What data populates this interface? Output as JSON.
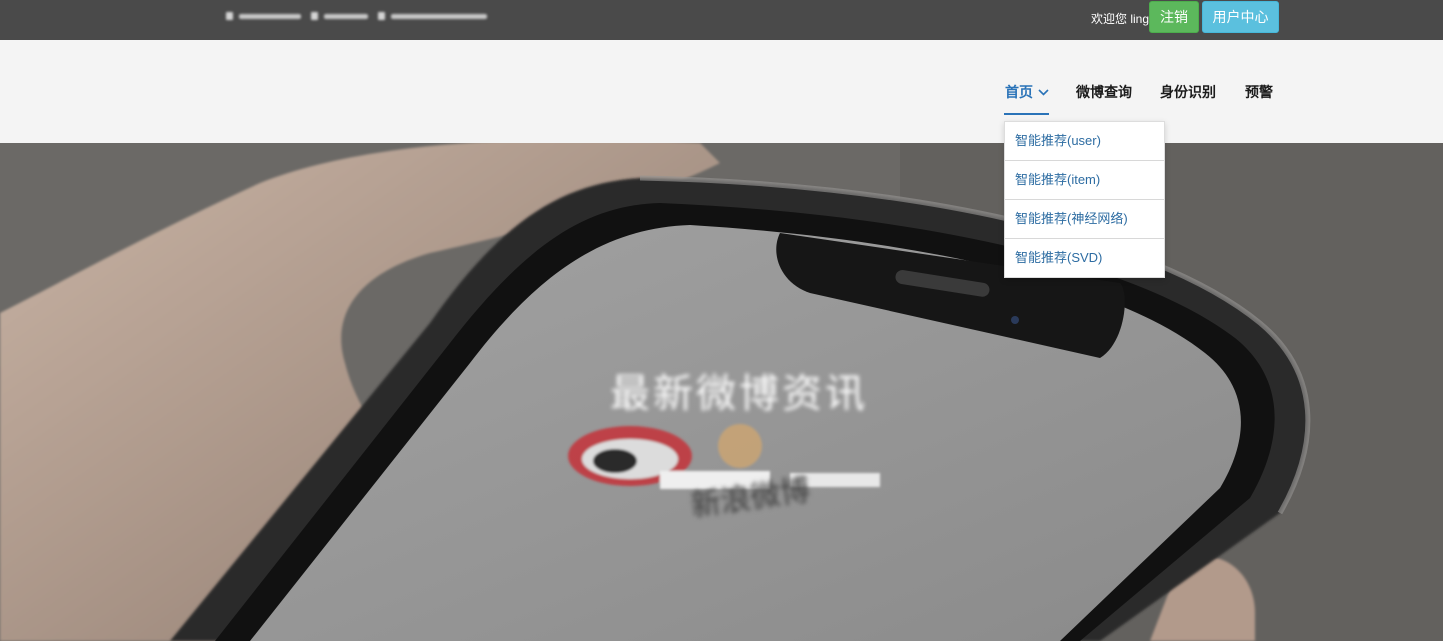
{
  "topbar": {
    "contact": [
      {
        "icon": "phone-icon"
      },
      {
        "icon": "mail-icon"
      },
      {
        "icon": "location-icon"
      }
    ],
    "welcome_text": "欢迎您 ling",
    "logout_label": "注销",
    "user_center_label": "用户中心",
    "colors": {
      "background": "#4a4a4a",
      "logout": "#5cb85c",
      "user_center": "#5bc0de"
    }
  },
  "nav": {
    "items": [
      {
        "label": "首页",
        "active": true,
        "icon": "chevron-down-icon"
      },
      {
        "label": "微博查询"
      },
      {
        "label": "身份识别"
      },
      {
        "label": "预警"
      }
    ],
    "accent": "#2a73b8",
    "dropdown": [
      {
        "label": "智能推荐(user)"
      },
      {
        "label": "智能推荐(item)"
      },
      {
        "label": "智能推荐(神经网络)"
      },
      {
        "label": "智能推荐(SVD)"
      }
    ]
  },
  "hero": {
    "title": "最新微博资讯",
    "subtitle": "新浪微博"
  }
}
